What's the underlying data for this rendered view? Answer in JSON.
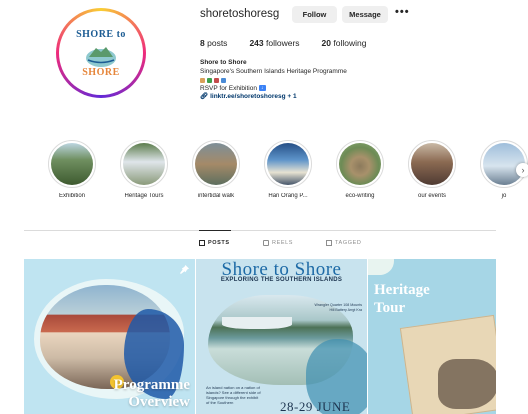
{
  "profile": {
    "username": "shoretoshoresg",
    "follow_label": "Follow",
    "message_label": "Message",
    "more_label": "•••",
    "posts_count": "8",
    "posts_label": "posts",
    "followers_count": "243",
    "followers_label": "followers",
    "following_count": "20",
    "following_label": "following",
    "display_name": "Shore to Shore",
    "bio_line": "Singapore's Southern Islands Heritage Programme",
    "rsvp_text": "RSVP for Exhibition",
    "link_text": "linktr.ee/shoretoshoresg + 1",
    "avatar_top_text": "SHORE to",
    "avatar_bottom_text": "SHORE"
  },
  "highlights": [
    {
      "label": "Exhibition"
    },
    {
      "label": "Heritage Tours"
    },
    {
      "label": "intertidal walk"
    },
    {
      "label": "Hari Orang P..."
    },
    {
      "label": "eco-writing"
    },
    {
      "label": "our events"
    },
    {
      "label": "jo"
    }
  ],
  "tabs": {
    "posts": "POSTS",
    "reels": "REELS",
    "tagged": "TAGGED"
  },
  "posts": {
    "post1_title_line1": "Programme",
    "post1_title_line2": "Overview",
    "post2_title": "Shore to Shore",
    "post2_subtitle": "EXPLORING THE SOUTHERN ISLANDS",
    "post2_note": "Wrangler Quarter 108 Mounts Hill Battery Arrgt Kra",
    "post2_body": "An island nation on a nation of islands? See a different side of Singapore through the exhibit of the Southern",
    "post2_date": "28-29 JUNE",
    "post3_title_line1": "Heritage",
    "post3_title_line2": "Tour"
  },
  "colors": {
    "accent_link": "#00376b",
    "button_bg": "#efefef",
    "divider": "#dbdbdb"
  }
}
